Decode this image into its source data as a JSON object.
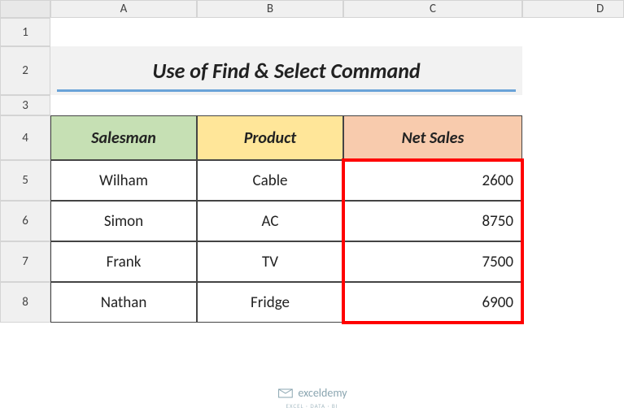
{
  "columns": [
    "A",
    "B",
    "C",
    "D"
  ],
  "rows": [
    "1",
    "2",
    "3",
    "4",
    "5",
    "6",
    "7",
    "8"
  ],
  "title": "Use of Find & Select Command",
  "headers": {
    "salesman": "Salesman",
    "product": "Product",
    "netsales": "Net Sales"
  },
  "data": [
    {
      "salesman": "Wilham",
      "product": "Cable",
      "netsales": "2600"
    },
    {
      "salesman": "Simon",
      "product": "AC",
      "netsales": "8750"
    },
    {
      "salesman": "Frank",
      "product": "TV",
      "netsales": "7500"
    },
    {
      "salesman": "Nathan",
      "product": "Fridge",
      "netsales": "6900"
    }
  ],
  "footer": {
    "brand": "exceldemy",
    "tagline": "EXCEL · DATA · BI"
  },
  "chart_data": {
    "type": "table",
    "title": "Use of Find & Select Command",
    "columns": [
      "Salesman",
      "Product",
      "Net Sales"
    ],
    "rows": [
      [
        "Wilham",
        "Cable",
        2600
      ],
      [
        "Simon",
        "AC",
        8750
      ],
      [
        "Frank",
        "TV",
        7500
      ],
      [
        "Nathan",
        "Fridge",
        6900
      ]
    ],
    "highlighted_range": "D5:D8"
  }
}
